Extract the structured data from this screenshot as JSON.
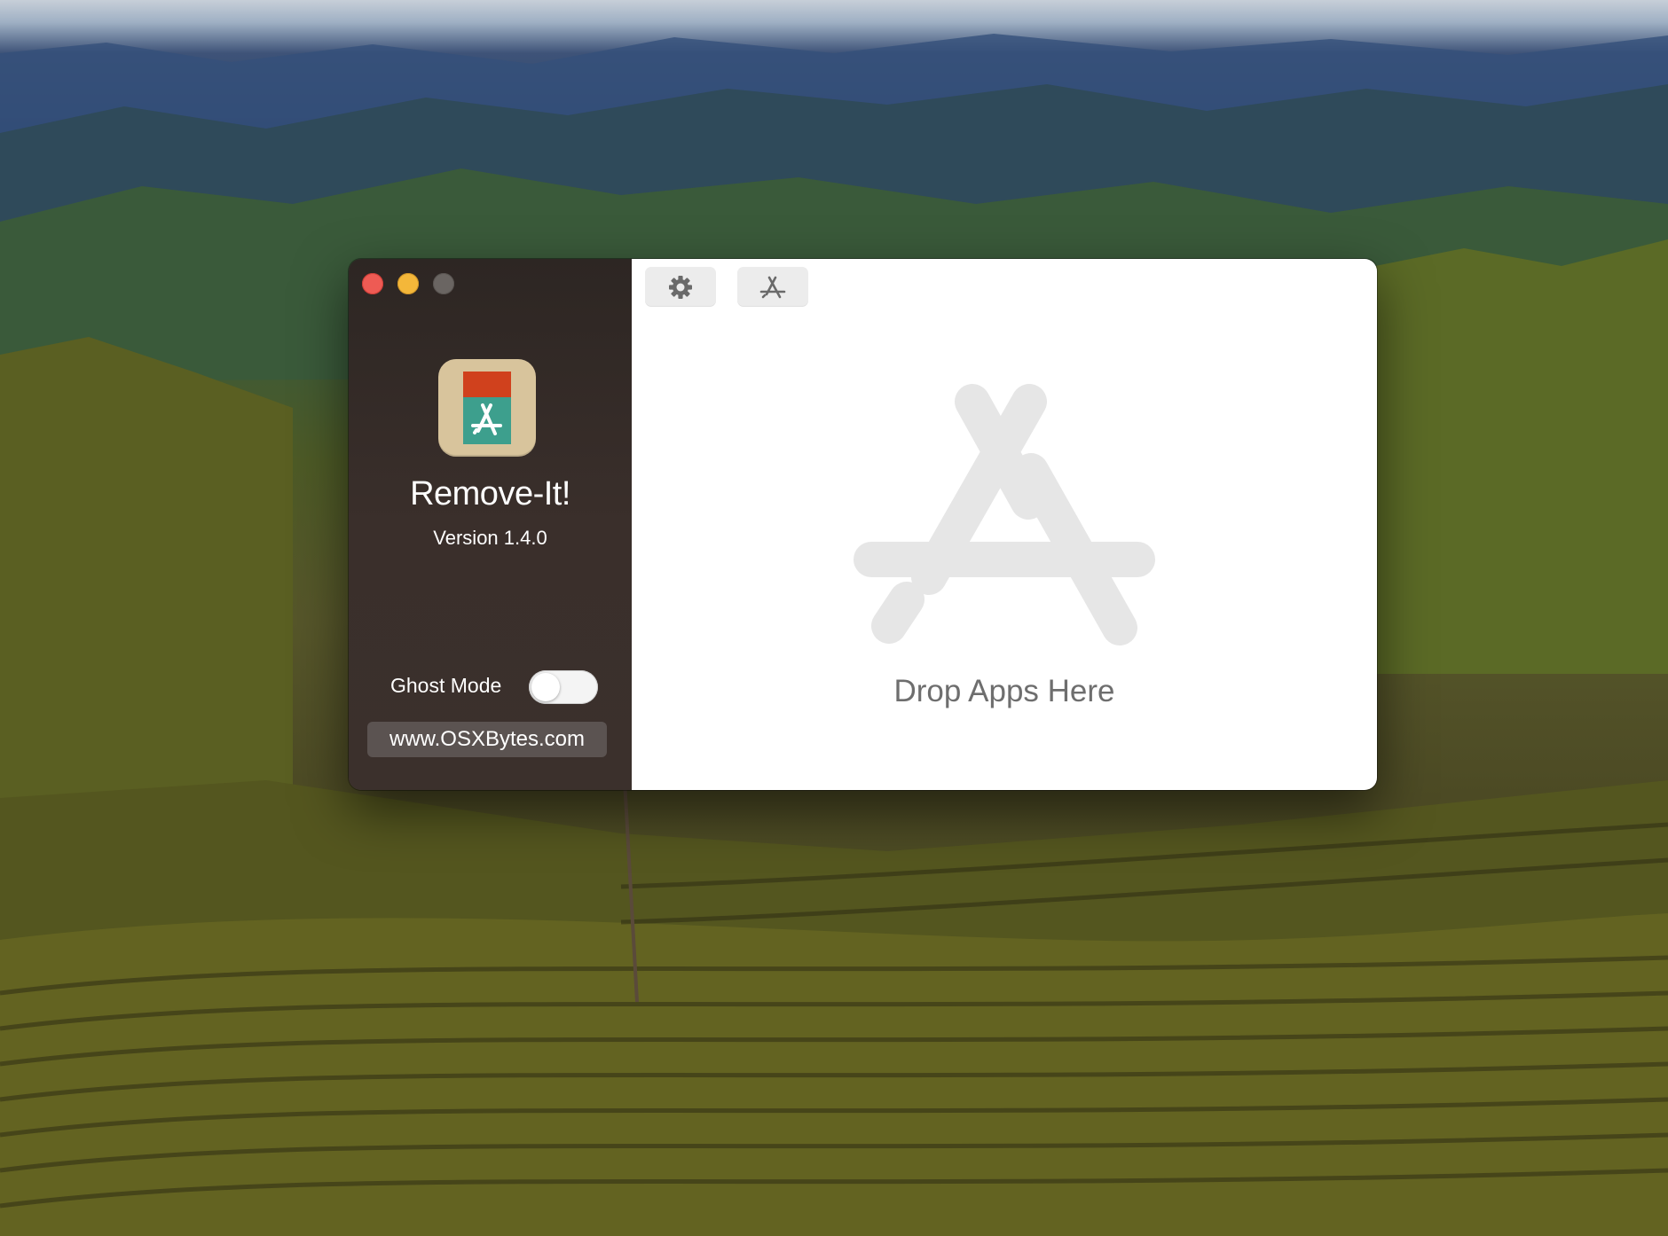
{
  "app": {
    "name": "Remove-It!",
    "version": "Version 1.4.0"
  },
  "sidebar": {
    "ghost_mode_label": "Ghost Mode",
    "ghost_mode_enabled": false,
    "website_label": "www.OSXBytes.com"
  },
  "toolbar": {
    "buttons": [
      {
        "icon": "gear-icon"
      },
      {
        "icon": "app-store-icon"
      }
    ]
  },
  "main": {
    "drop_label": "Drop Apps Here",
    "drop_icon": "app-store-icon"
  },
  "colors": {
    "close": "#ee5b54",
    "minimize": "#f4b73a",
    "maximize_inactive": "#6a6562",
    "icon_red": "#d0411d",
    "icon_teal": "#3d9f8d",
    "icon_beige": "#d8c49c",
    "sidebar_bg": "#3a2f2b"
  }
}
